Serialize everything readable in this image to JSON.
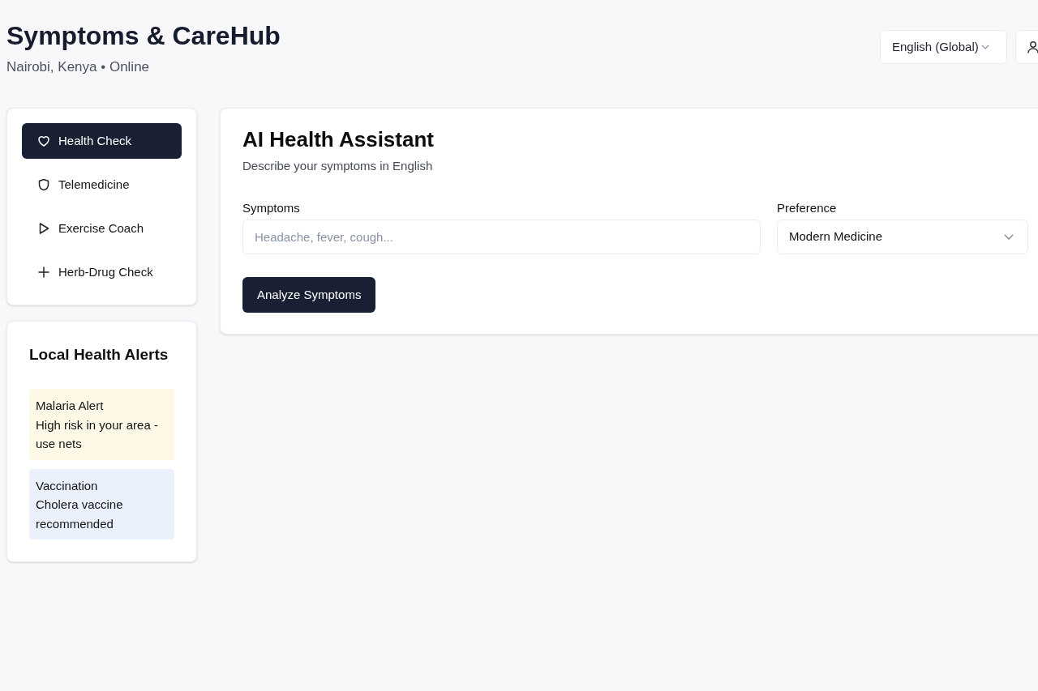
{
  "header": {
    "title": "Symptoms & CareHub",
    "subtitle": "Nairobi, Kenya • Online",
    "language": "English (Global)"
  },
  "sidebar": {
    "items": [
      {
        "label": "Health Check",
        "selected": true
      },
      {
        "label": "Telemedicine",
        "selected": false
      },
      {
        "label": "Exercise Coach",
        "selected": false
      },
      {
        "label": "Herb-Drug Check",
        "selected": false
      }
    ]
  },
  "alerts": {
    "title": "Local Health Alerts",
    "items": [
      {
        "title": "Malaria Alert",
        "message": "High risk in your area - use nets",
        "color": "#fdf9e6"
      },
      {
        "title": "Vaccination",
        "message": "Cholera vaccine recommended",
        "color": "#eaf1fc"
      }
    ]
  },
  "assistant": {
    "title": "AI Health Assistant",
    "subtitle": "Describe your symptoms in English",
    "symptoms": {
      "label": "Symptoms",
      "placeholder": "Headache, fever, cough..."
    },
    "preference": {
      "label": "Preference",
      "value": "Modern Medicine"
    },
    "button": "Analyze Symptoms"
  }
}
